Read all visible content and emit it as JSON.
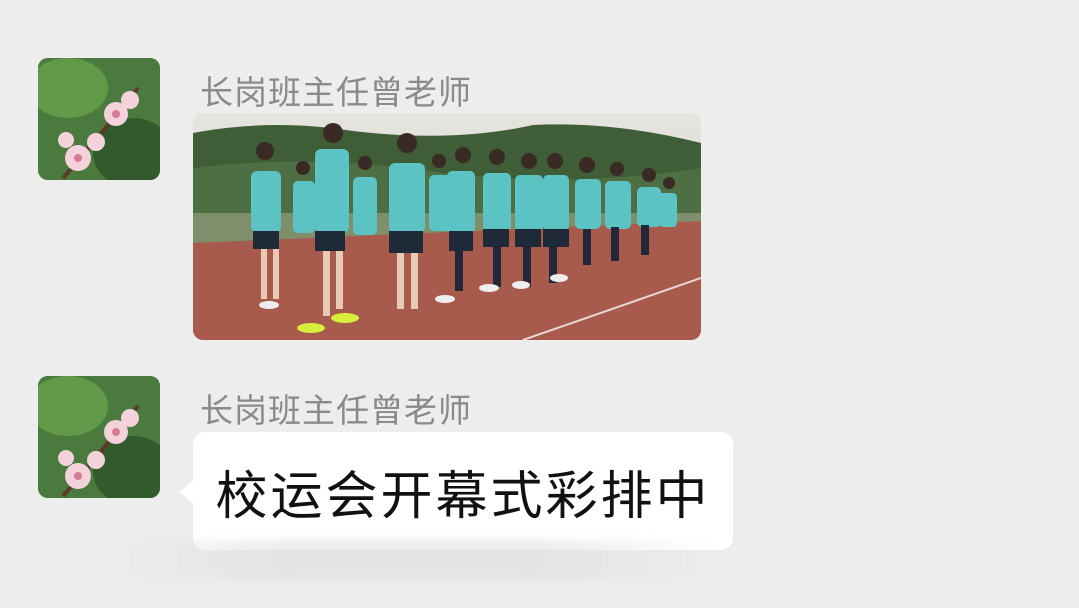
{
  "chat": {
    "messages": [
      {
        "sender": "长岗班主任曾老师",
        "type": "image",
        "avatar_icon": "peach-blossom-avatar",
        "image_description_icon": "students-on-track-photo"
      },
      {
        "sender": "长岗班主任曾老师",
        "type": "text",
        "avatar_icon": "peach-blossom-avatar",
        "text": "校运会开幕式彩排中"
      }
    ]
  },
  "colors": {
    "background": "#ededed",
    "bubble": "#ffffff",
    "sender_name": "#8a8a8a",
    "message_text": "#111111",
    "track": "#a85a4c",
    "uniform": "#5cc3c4"
  }
}
